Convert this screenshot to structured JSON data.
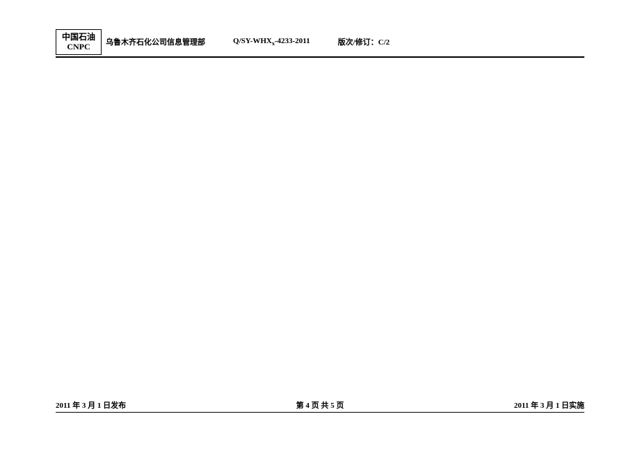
{
  "header": {
    "logo": {
      "cn": "中国石油",
      "en": "CNPC"
    },
    "department": "乌鲁木齐石化公司信息管理部",
    "doc_code_prefix": "Q/SY-WHX",
    "doc_code_sub": "x",
    "doc_code_suffix": "-4233-2011",
    "revision_label": "版次/修订：",
    "revision_value": "C/2"
  },
  "footer": {
    "publish_date": "2011 年 3 月 1 日发布",
    "page_info": "第  4  页  共  5  页",
    "implement_date": "2011 年 3 月 1 日实施"
  }
}
